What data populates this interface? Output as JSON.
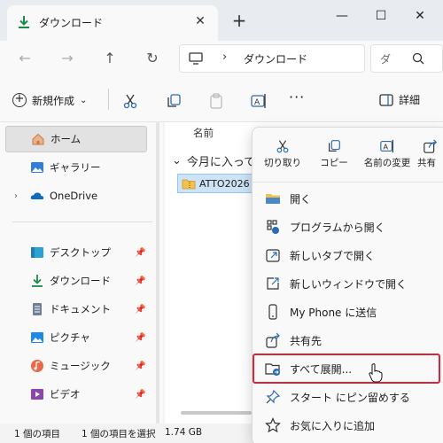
{
  "window": {
    "tab_title": "ダウンロード",
    "new_tab": "+",
    "controls": {
      "minimize": "—",
      "maximize": "☐",
      "close": "✕"
    },
    "tab_close": "✕"
  },
  "nav": {
    "back": "←",
    "forward": "→",
    "up": "↑",
    "refresh": "↻"
  },
  "address": {
    "chevron": "›",
    "location": "ダウンロード"
  },
  "search": {
    "placeholder": "ダ"
  },
  "commandbar": {
    "new_label": "新規作成",
    "new_chevron": "⌄",
    "more": "···",
    "details_label": "詳細"
  },
  "sidebar": {
    "items": [
      {
        "label": "ホーム",
        "icon": "home-icon"
      },
      {
        "label": "ギャラリー",
        "icon": "gallery-icon"
      },
      {
        "label": "OneDrive",
        "icon": "onedrive-icon"
      },
      {
        "label": "デスクトップ",
        "icon": "desktop-icon"
      },
      {
        "label": "ダウンロード",
        "icon": "download-icon"
      },
      {
        "label": "ドキュメント",
        "icon": "documents-icon"
      },
      {
        "label": "ピクチャ",
        "icon": "pictures-icon"
      },
      {
        "label": "ミュージック",
        "icon": "music-icon"
      },
      {
        "label": "ビデオ",
        "icon": "videos-icon"
      }
    ],
    "expand_chevron": "›",
    "pin": "📌"
  },
  "main": {
    "column_name": "名前",
    "group_label": "今月に入って",
    "group_chevron": "⌄",
    "file_name": "ATTO2026"
  },
  "status": {
    "item_count": "1 個の項目",
    "selected": "1 個の項目を選択",
    "size": "1.74 GB"
  },
  "context_menu": {
    "toolbar": [
      {
        "label": "切り取り",
        "icon": "cut-icon"
      },
      {
        "label": "コピー",
        "icon": "copy-icon"
      },
      {
        "label": "名前の変更",
        "icon": "rename-icon"
      },
      {
        "label": "共有",
        "icon": "share-icon"
      }
    ],
    "items": [
      {
        "label": "開く",
        "icon": "folder-open-icon"
      },
      {
        "label": "プログラムから開く",
        "icon": "open-with-icon"
      },
      {
        "label": "新しいタブで開く",
        "icon": "new-tab-icon"
      },
      {
        "label": "新しいウィンドウで開く",
        "icon": "new-window-icon"
      },
      {
        "label": "My Phone に送信",
        "icon": "phone-icon"
      },
      {
        "label": "共有先",
        "icon": "share-to-icon"
      },
      {
        "label": "すべて展開...",
        "icon": "extract-all-icon"
      },
      {
        "label": "スタート にピン留めする",
        "icon": "pin-start-icon"
      },
      {
        "label": "お気に入りに追加",
        "icon": "star-icon"
      }
    ]
  },
  "colors": {
    "highlight": "#d6263b",
    "selection": "#cde4f7",
    "accent": "#1a8c4a"
  }
}
